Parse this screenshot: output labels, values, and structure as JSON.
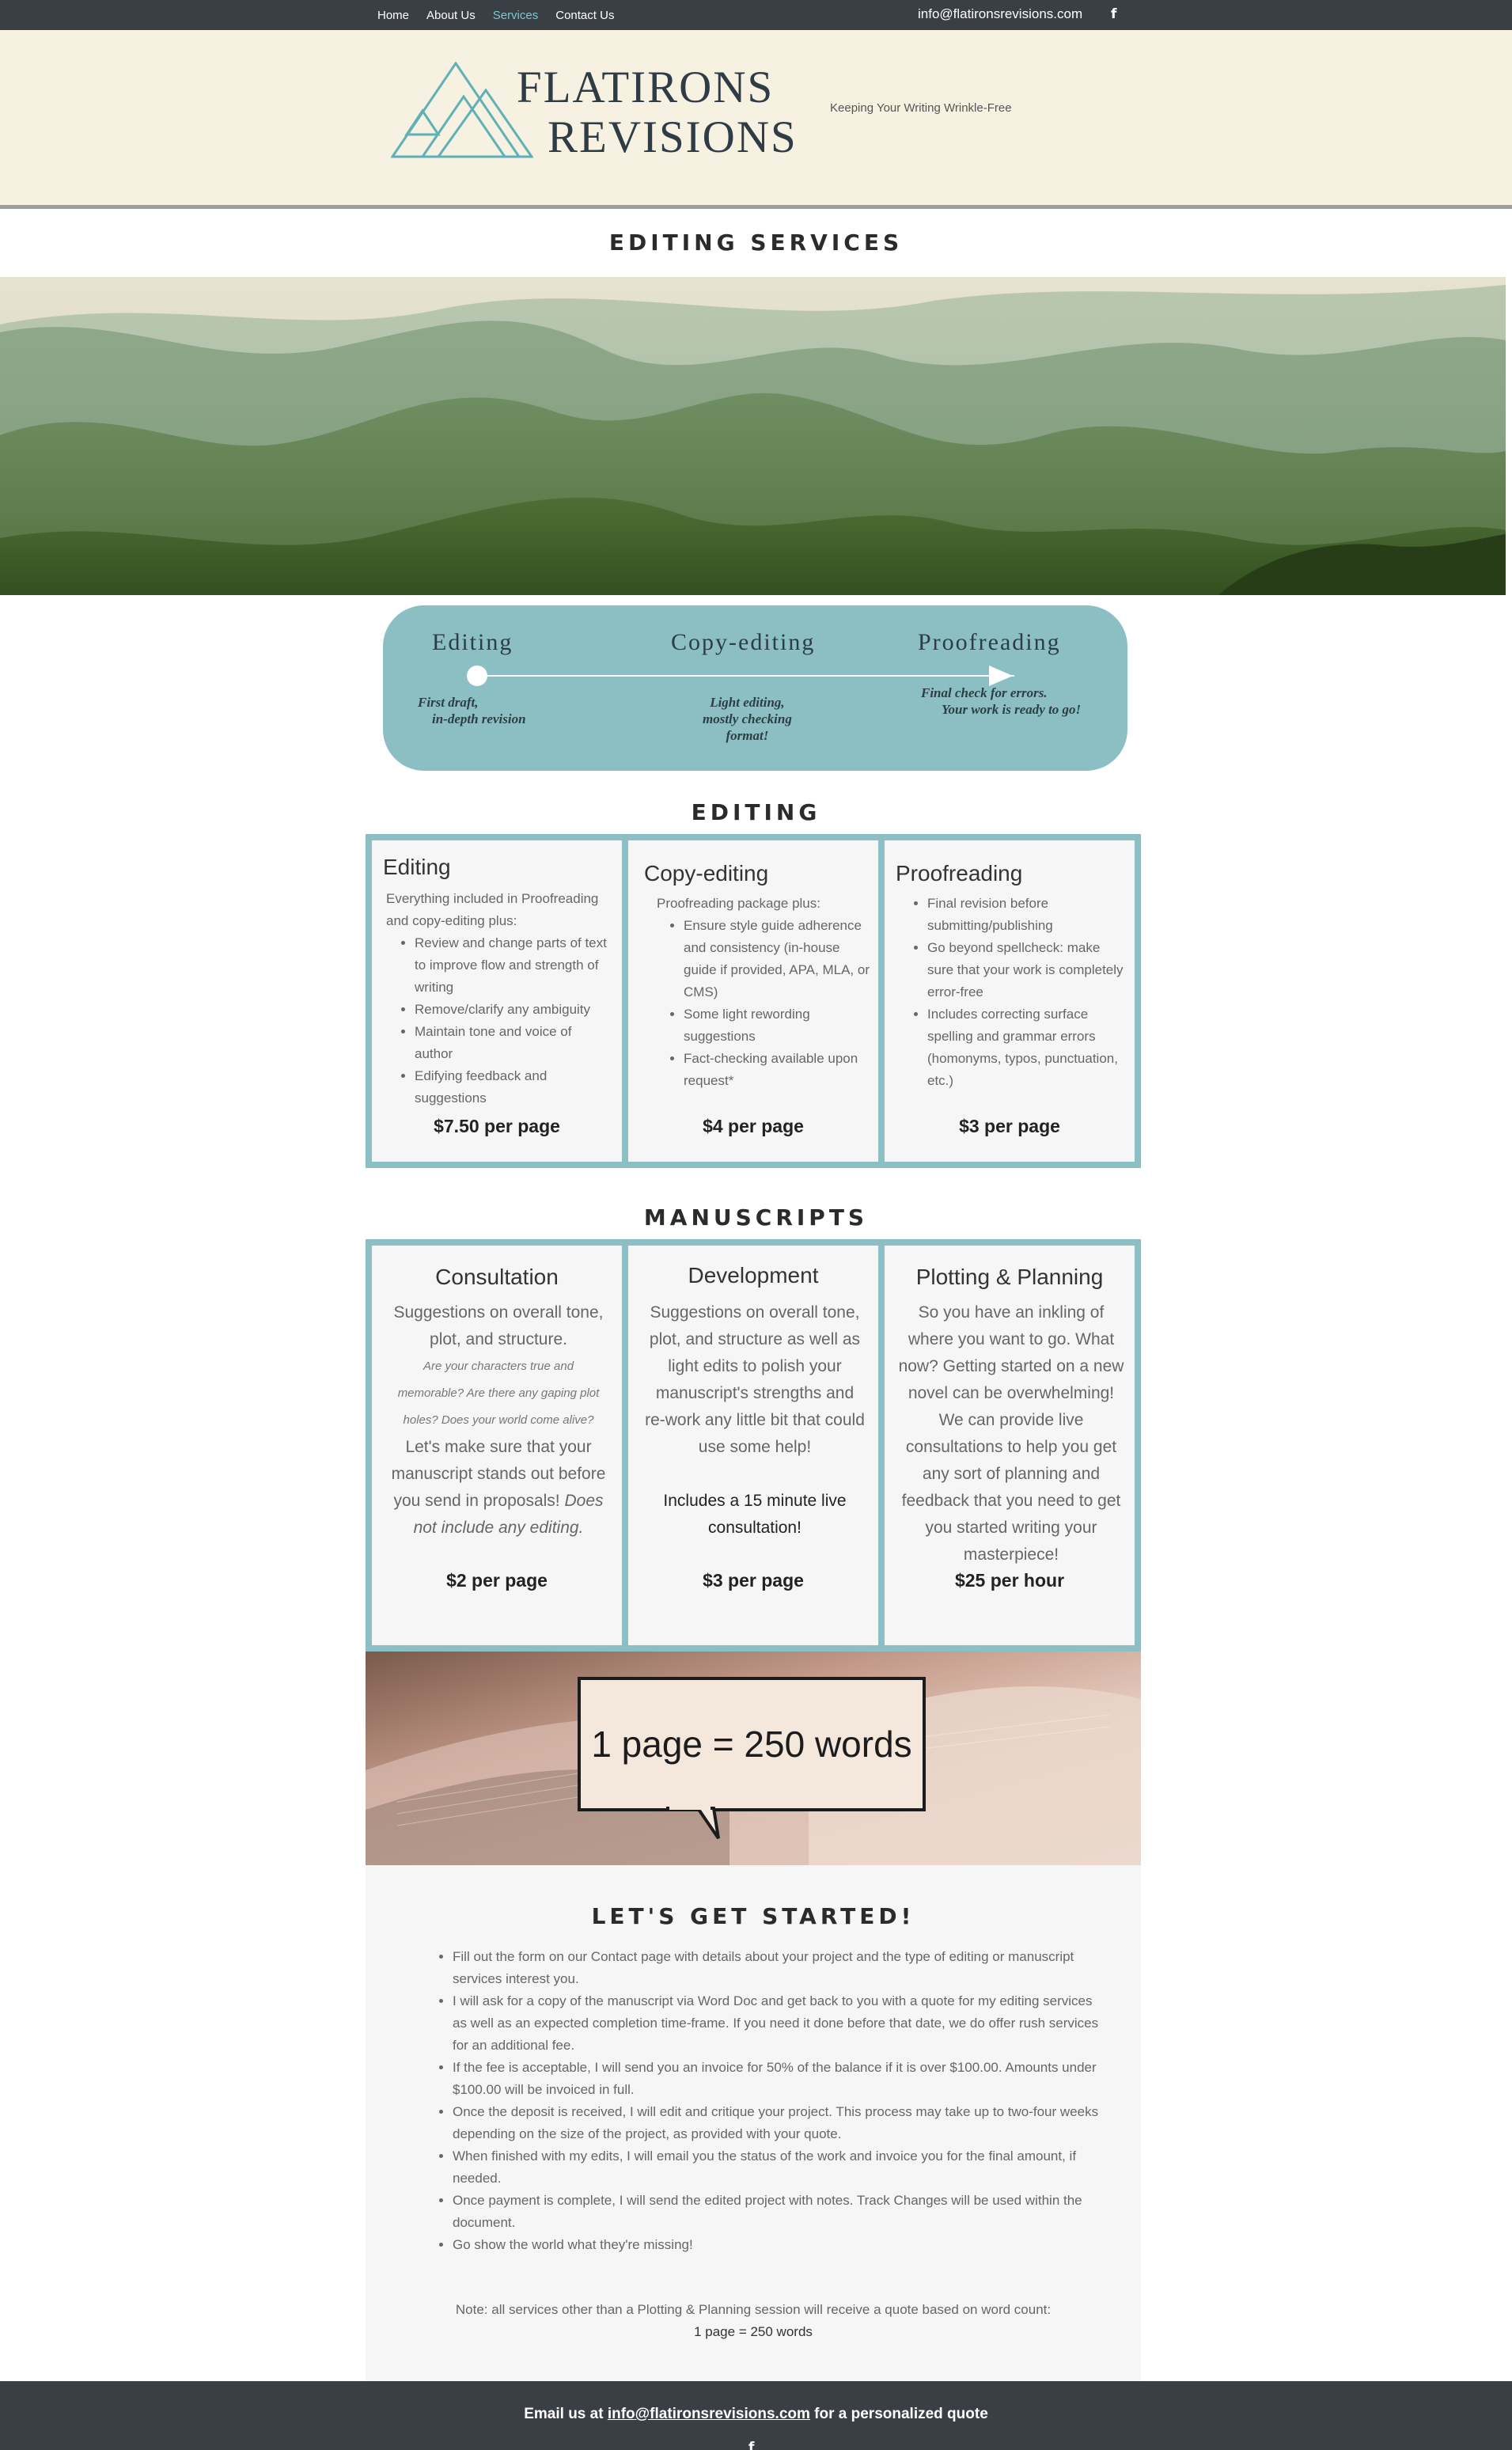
{
  "nav": {
    "items": [
      {
        "label": "Home"
      },
      {
        "label": "About Us"
      },
      {
        "label": "Services"
      },
      {
        "label": "Contact Us"
      }
    ],
    "email": "info@flatironsrevisions.com",
    "facebook_icon": "f"
  },
  "header": {
    "logo_line1": "FLATIRONS",
    "logo_line2": "REVISIONS",
    "tagline": "Keeping Your Writing Wrinkle-Free",
    "accent_color": "#5fb0b7"
  },
  "page_title": "EDITING SERVICES",
  "process": {
    "steps": [
      {
        "label": "Editing",
        "note1": "First draft,",
        "note2": "in-depth revision",
        "note3": ""
      },
      {
        "label": "Copy-editing",
        "note1": "Light editing,",
        "note2": "mostly checking",
        "note3": "format!"
      },
      {
        "label": "Proofreading",
        "note1": "Final check for errors.",
        "note2": "Your work is ready to go!",
        "note3": ""
      }
    ]
  },
  "editing": {
    "title": "EDITING",
    "cards": [
      {
        "title": "Editing",
        "intro": "Everything included in Proofreading and copy-editing plus:",
        "bullets": [
          "Review and change parts of text to improve  flow and strength of writing",
          "Remove/clarify any ambiguity",
          "Maintain tone and voice of author",
          "Edifying feedback and suggestions"
        ],
        "price": "$7.50 per page"
      },
      {
        "title": "Copy-editing",
        "intro": "Proofreading package plus:",
        "bullets": [
          "Ensure style guide adherence and consistency (in-house guide if provided, APA, MLA, or CMS)",
          "Some light rewording suggestions",
          "Fact-checking available upon request*"
        ],
        "price": "$4 per page"
      },
      {
        "title": "Proofreading",
        "intro": "",
        "bullets": [
          "Final revision before submitting/publishing",
          "Go beyond spellcheck: make sure that your work is completely error-free",
          "Includes correcting surface spelling and grammar errors (homonyms, typos, punctuation, etc.)"
        ],
        "price": "$3 per page"
      }
    ]
  },
  "manuscripts": {
    "title": "MANUSCRIPTS",
    "cards": [
      {
        "title": "Consultation",
        "body1": "Suggestions on overall tone, plot, and structure.",
        "italic": "Are your characters true and memorable? Are there any gaping plot holes? Does your world come alive?",
        "body2": "Let's make sure that your manuscript stands out before you send in proposals!",
        "body2_italic": "Does not include any editing.",
        "price": "$2 per page"
      },
      {
        "title": "Development",
        "body1": "Suggestions on overall tone, plot, and structure as well as light edits to polish your manuscript's strengths and re-work any little bit that could use some help!",
        "highlight": "Includes a 15 minute live consultation!",
        "price": "$3 per page"
      },
      {
        "title": "Plotting & Planning",
        "body1": "So you have an inkling of where you want to go. What now? Getting started on a new novel can be overwhelming! We can provide live consultations to help you get any sort of planning and feedback that you need to get you started writing your masterpiece!",
        "price": "$25 per hour"
      }
    ]
  },
  "banner": {
    "text": "1 page = 250 words"
  },
  "get_started": {
    "title": "LET'S GET STARTED!",
    "steps": [
      "Fill out the form on our Contact page with details about your project and the type of editing or manuscript services interest you.",
      "I will ask for a copy of the manuscript via Word Doc and get back to you with a quote for my editing services as well as an expected completion time-frame. If you need it done before that date, we do offer rush services for an additional fee.",
      "If the fee is acceptable, I will send you an invoice for 50% of the balance if it is over $100.00. Amounts under $100.00 will be invoiced in full.",
      "Once the deposit is received, I will edit and critique your project. This process may take up to two-four weeks depending on the size of the project, as provided with your quote.",
      "When finished with my edits, I will email you the status of the work and invoice you for the final amount, if needed.",
      "Once payment is complete, I will send the edited project with notes. Track Changes will be used within the document.",
      "Go show the world what they're missing!"
    ],
    "note_line1": "Note: all services other than a Plotting & Planning session will receive a quote based on word count:",
    "note_line2": "1 page = 250 words"
  },
  "footer": {
    "prefix": "Email us at ",
    "email": "info@flatironsrevisions.com",
    "suffix": " for a personalized quote",
    "facebook_icon": "f"
  }
}
